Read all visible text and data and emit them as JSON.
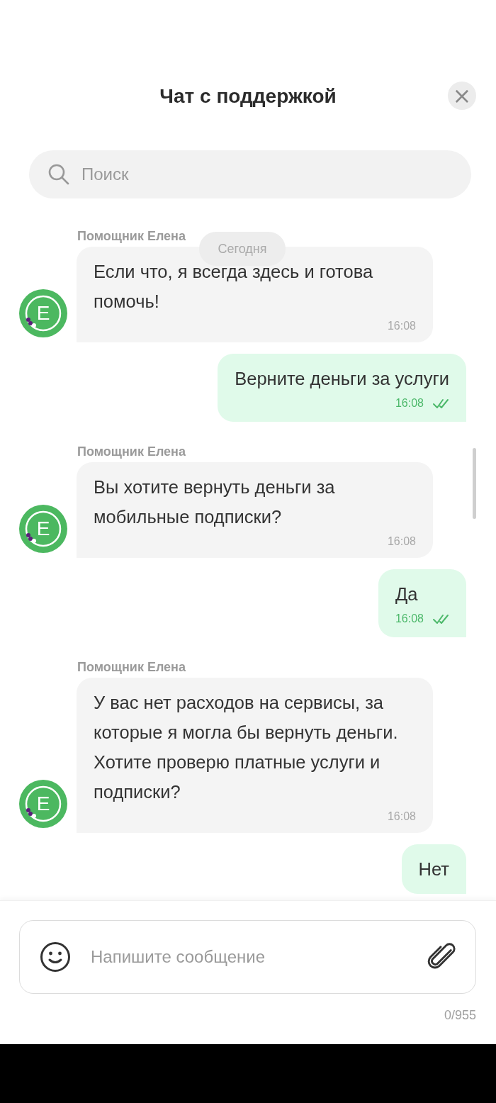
{
  "header": {
    "title": "Чат с поддержкой",
    "close": "×"
  },
  "search": {
    "placeholder": "Поиск"
  },
  "date_divider": "Сегодня",
  "messages": [
    {
      "kind": "incoming",
      "sender": "Помощник Елена",
      "avatar_letter": "Е",
      "text": "Если что, я всегда здесь и готова помочь!",
      "time": "16:08"
    },
    {
      "kind": "outgoing",
      "text": "Верните деньги за услуги",
      "time": "16:08",
      "read": true
    },
    {
      "kind": "incoming",
      "sender": "Помощник Елена",
      "avatar_letter": "Е",
      "text": "Вы хотите вернуть деньги за мобильные подписки?",
      "time": "16:08"
    },
    {
      "kind": "outgoing",
      "text": "Да",
      "time": "16:08",
      "read": true
    },
    {
      "kind": "incoming",
      "sender": "Помощник Елена",
      "avatar_letter": "Е",
      "text": "У вас нет расходов на сервисы, за которые я могла бы вернуть деньги. Хотите проверю платные услуги и подписки?",
      "time": "16:08"
    },
    {
      "kind": "outgoing",
      "text": "Нет"
    }
  ],
  "composer": {
    "placeholder": "Напишите сообщение",
    "counter": "0/955"
  }
}
